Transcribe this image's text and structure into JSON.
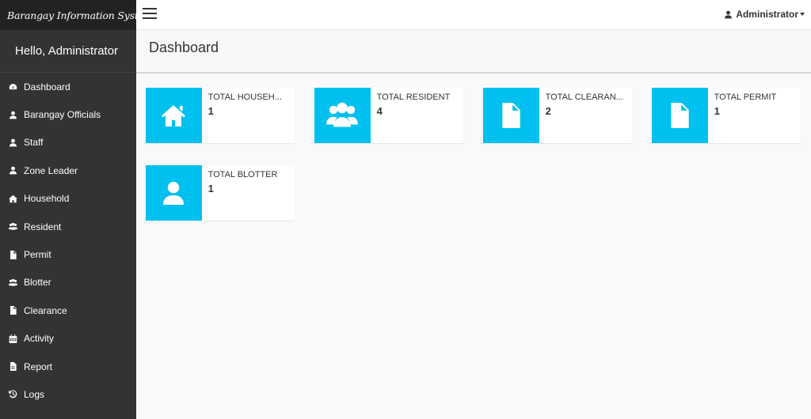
{
  "brand": {
    "title": "Barangay Information System"
  },
  "sidebar": {
    "greeting": "Hello, Administrator",
    "items": [
      {
        "label": "Dashboard",
        "icon": "dashboard-icon"
      },
      {
        "label": "Barangay Officials",
        "icon": "user-icon"
      },
      {
        "label": "Staff",
        "icon": "user-icon"
      },
      {
        "label": "Zone Leader",
        "icon": "user-icon"
      },
      {
        "label": "Household",
        "icon": "home-icon"
      },
      {
        "label": "Resident",
        "icon": "users-icon"
      },
      {
        "label": "Permit",
        "icon": "file-icon"
      },
      {
        "label": "Blotter",
        "icon": "users-icon"
      },
      {
        "label": "Clearance",
        "icon": "file-icon"
      },
      {
        "label": "Activity",
        "icon": "calendar-icon"
      },
      {
        "label": "Report",
        "icon": "file-text-icon"
      },
      {
        "label": "Logs",
        "icon": "history-icon"
      }
    ]
  },
  "topbar": {
    "user": "Administrator"
  },
  "header": {
    "title": "Dashboard"
  },
  "boxes": [
    {
      "label": "TOTAL HOUSEH...",
      "value": "1",
      "icon": "home-icon"
    },
    {
      "label": "TOTAL RESIDENT",
      "value": "4",
      "icon": "users-icon"
    },
    {
      "label": "TOTAL CLEARAN...",
      "value": "2",
      "icon": "file-icon"
    },
    {
      "label": "TOTAL PERMIT",
      "value": "1",
      "icon": "file-icon"
    },
    {
      "label": "TOTAL BLOTTER",
      "value": "1",
      "icon": "user-icon"
    }
  ],
  "colors": {
    "sidebar": "#333333",
    "brand_bar": "#222222",
    "accent": "#00c0ef"
  }
}
